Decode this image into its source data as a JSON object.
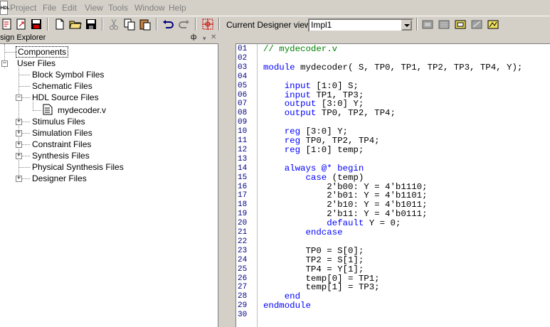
{
  "app_icon_text": "HDL",
  "menu": [
    "Project",
    "File",
    "Edit",
    "View",
    "Tools",
    "Window",
    "Help"
  ],
  "toolbar": {
    "designer_view_label": "Current Designer view:",
    "designer_view_value": "Impl1",
    "buttons": [
      "new-project-icon",
      "open-project-icon",
      "save-project-icon",
      "new-file-icon",
      "open-file-icon",
      "save-file-icon",
      "cut-icon",
      "copy-icon",
      "paste-icon",
      "undo-icon",
      "redo-icon",
      "target-icon",
      "designer-tool-1-icon",
      "designer-tool-2-icon",
      "designer-tool-3-icon",
      "designer-tool-4-icon",
      "designer-tool-5-icon"
    ]
  },
  "explorer": {
    "title": "esign Explorer",
    "tree": [
      {
        "label": "Components",
        "expander": "",
        "selected": true
      },
      {
        "label": "User Files",
        "expander": "−"
      },
      {
        "label": "Block Symbol Files",
        "expander": ""
      },
      {
        "label": "Schematic Files",
        "expander": ""
      },
      {
        "label": "HDL Source Files",
        "expander": "−"
      },
      {
        "label": "mydecoder.v",
        "expander": ""
      },
      {
        "label": "Stimulus Files",
        "expander": "+"
      },
      {
        "label": "Simulation Files",
        "expander": "+"
      },
      {
        "label": "Constraint Files",
        "expander": "+"
      },
      {
        "label": "Synthesis Files",
        "expander": "+"
      },
      {
        "label": "Physical Synthesis Files",
        "expander": ""
      },
      {
        "label": "Designer Files",
        "expander": "+"
      }
    ]
  },
  "editor": {
    "line_numbers": [
      "01",
      "02",
      "03",
      "04",
      "05",
      "06",
      "07",
      "08",
      "09",
      "10",
      "11",
      "12",
      "13",
      "14",
      "15",
      "16",
      "17",
      "18",
      "19",
      "20",
      "21",
      "22",
      "23",
      "24",
      "25",
      "26",
      "27",
      "28",
      "29",
      "30"
    ],
    "lines": [
      {
        "indent": "",
        "kw": "",
        "text": "// mydecoder.v",
        "type": "comment"
      },
      {
        "indent": "",
        "kw": "",
        "text": "",
        "type": "plain"
      },
      {
        "indent": "",
        "kw": "module",
        "text": " mydecoder( S, TP0, TP1, TP2, TP3, TP4, Y);",
        "type": "kw"
      },
      {
        "indent": "",
        "kw": "",
        "text": "",
        "type": "plain"
      },
      {
        "indent": "    ",
        "kw": "input",
        "text": " [1:0] S;",
        "type": "kw"
      },
      {
        "indent": "    ",
        "kw": "input",
        "text": " TP1, TP3;",
        "type": "kw"
      },
      {
        "indent": "    ",
        "kw": "output",
        "text": " [3:0] Y;",
        "type": "kw"
      },
      {
        "indent": "    ",
        "kw": "output",
        "text": " TP0, TP2, TP4;",
        "type": "kw"
      },
      {
        "indent": "",
        "kw": "",
        "text": "",
        "type": "plain"
      },
      {
        "indent": "    ",
        "kw": "reg",
        "text": " [3:0] Y;",
        "type": "kw"
      },
      {
        "indent": "    ",
        "kw": "reg",
        "text": " TP0, TP2, TP4;",
        "type": "kw"
      },
      {
        "indent": "    ",
        "kw": "reg",
        "text": " [1:0] temp;",
        "type": "kw"
      },
      {
        "indent": "",
        "kw": "",
        "text": "",
        "type": "plain"
      },
      {
        "indent": "    ",
        "kw": "always @* begin",
        "text": "",
        "type": "kw"
      },
      {
        "indent": "        ",
        "kw": "case",
        "text": " (temp)",
        "type": "kw"
      },
      {
        "indent": "            ",
        "kw": "",
        "text": "2'b00: Y = 4'b1110;",
        "type": "plain"
      },
      {
        "indent": "            ",
        "kw": "",
        "text": "2'b01: Y = 4'b1101;",
        "type": "plain"
      },
      {
        "indent": "            ",
        "kw": "",
        "text": "2'b10: Y = 4'b1011;",
        "type": "plain"
      },
      {
        "indent": "            ",
        "kw": "",
        "text": "2'b11: Y = 4'b0111;",
        "type": "plain"
      },
      {
        "indent": "            ",
        "kw": "default",
        "text": " Y = 0;",
        "type": "kw"
      },
      {
        "indent": "        ",
        "kw": "endcase",
        "text": "",
        "type": "kw"
      },
      {
        "indent": "",
        "kw": "",
        "text": "",
        "type": "plain"
      },
      {
        "indent": "        ",
        "kw": "",
        "text": "TP0 = S[0];",
        "type": "plain"
      },
      {
        "indent": "        ",
        "kw": "",
        "text": "TP2 = S[1];",
        "type": "plain"
      },
      {
        "indent": "        ",
        "kw": "",
        "text": "TP4 = Y[1];",
        "type": "plain"
      },
      {
        "indent": "        ",
        "kw": "",
        "text": "temp[0] = TP1;",
        "type": "plain"
      },
      {
        "indent": "        ",
        "kw": "",
        "text": "temp[1] = TP3;",
        "type": "plain"
      },
      {
        "indent": "    ",
        "kw": "end",
        "text": "",
        "type": "kw"
      },
      {
        "indent": "",
        "kw": "endmodule",
        "text": "",
        "type": "kw"
      },
      {
        "indent": "",
        "kw": "",
        "text": "",
        "type": "plain"
      }
    ]
  }
}
